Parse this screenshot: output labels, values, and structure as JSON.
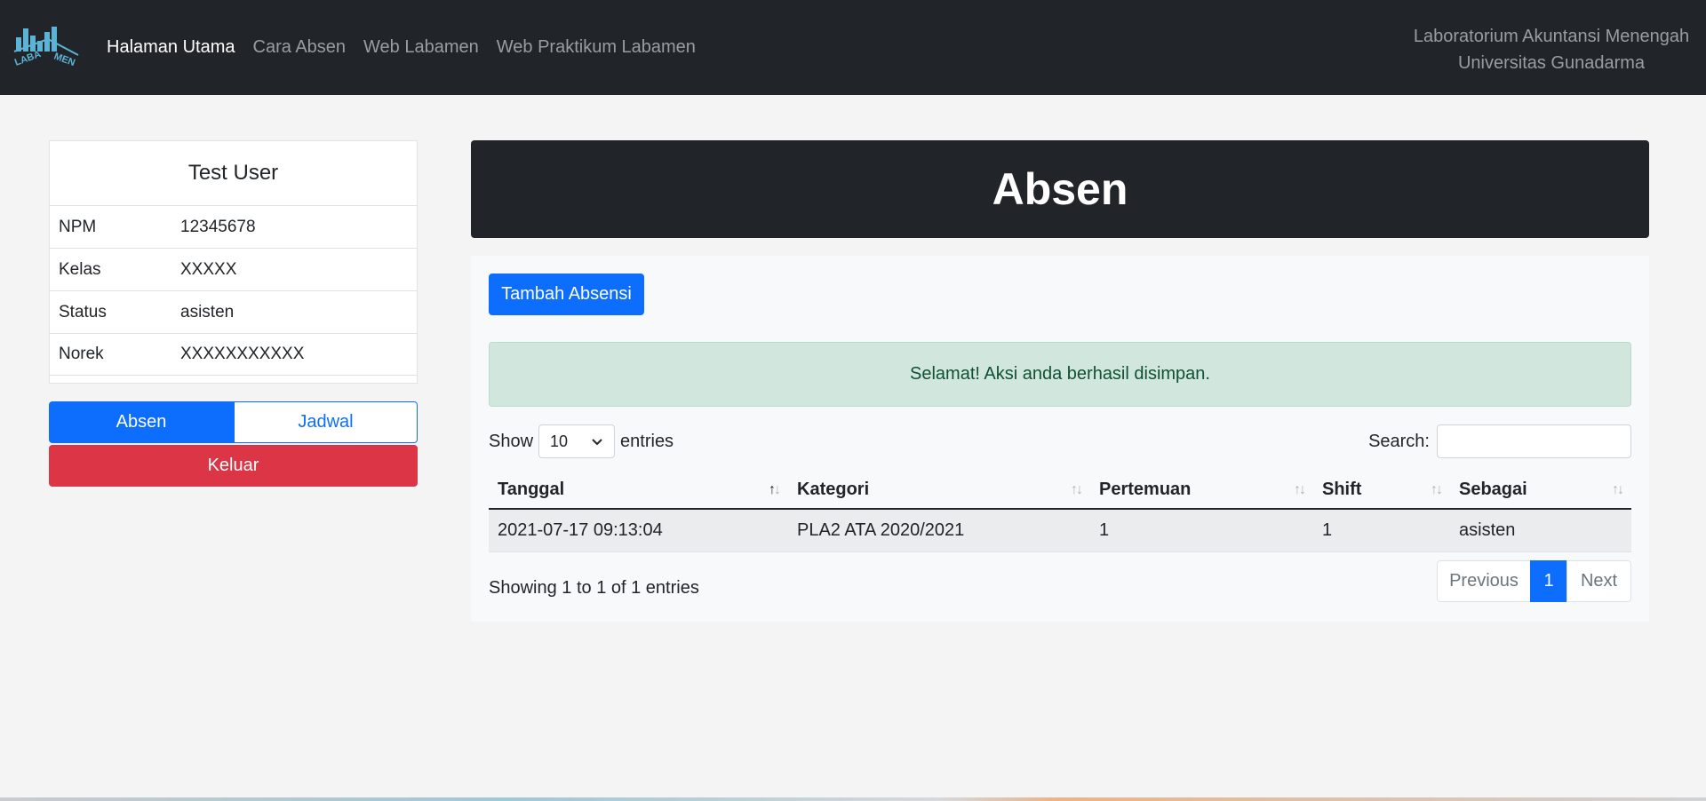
{
  "nav": {
    "logo_text_top": "LABA",
    "logo_text_bottom": "MEN",
    "links": [
      {
        "label": "Halaman Utama",
        "active": true
      },
      {
        "label": "Cara Absen",
        "active": false
      },
      {
        "label": "Web Labamen",
        "active": false
      },
      {
        "label": "Web Praktikum Labamen",
        "active": false
      }
    ],
    "org_line1": "Laboratorium Akuntansi Menengah",
    "org_line2": "Universitas Gunadarma"
  },
  "profile": {
    "name": "Test User",
    "fields": [
      {
        "label": "NPM",
        "value": "12345678"
      },
      {
        "label": "Kelas",
        "value": "XXXXX"
      },
      {
        "label": "Status",
        "value": "asisten"
      },
      {
        "label": "Norek",
        "value": "XXXXXXXXXXX"
      }
    ],
    "absen_label": "Absen",
    "jadwal_label": "Jadwal",
    "keluar_label": "Keluar"
  },
  "main": {
    "title": "Absen",
    "add_button": "Tambah Absensi",
    "alert": "Selamat! Aksi anda berhasil disimpan.",
    "show_label": "Show",
    "entries_value": "10",
    "entries_label": "entries",
    "search_label": "Search:",
    "search_value": "",
    "columns": [
      "Tanggal",
      "Kategori",
      "Pertemuan",
      "Shift",
      "Sebagai"
    ],
    "rows": [
      [
        "2021-07-17 09:13:04",
        "PLA2 ATA 2020/2021",
        "1",
        "1",
        "asisten"
      ]
    ],
    "info": "Showing 1 to 1 of 1 entries",
    "pagination": {
      "previous": "Previous",
      "current": "1",
      "next": "Next"
    }
  },
  "colors": {
    "navbar": "#212529",
    "primary": "#0d6efd",
    "danger": "#dc3545",
    "success_bg": "#d1e7dd",
    "success_text": "#0f5132",
    "logo": "#5bb4d6"
  }
}
